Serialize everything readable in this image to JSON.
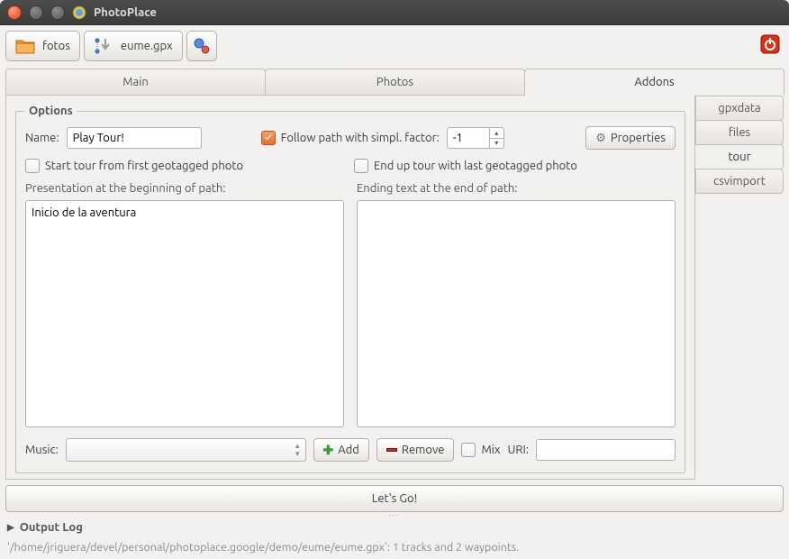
{
  "window": {
    "title": "PhotoPlace"
  },
  "toolbar": {
    "fotos_label": "fotos",
    "gpx_label": "eume.gpx"
  },
  "tabs": {
    "main": "Main",
    "photos": "Photos",
    "addons": "Addons"
  },
  "side_tabs": {
    "gpxdata": "gpxdata",
    "files": "files",
    "tour": "tour",
    "csvimport": "csvimport"
  },
  "options": {
    "legend": "Options",
    "name_label": "Name:",
    "name_value": "Play Tour!",
    "follow_label": "Follow path with simpl. factor:",
    "follow_checked": true,
    "factor_value": "-1",
    "properties_label": "Properties",
    "start_label": "Start tour from first geotagged photo",
    "start_checked": false,
    "end_label": "End up tour with last geotagged photo",
    "end_checked": false,
    "presentation_label": "Presentation at the beginning of path:",
    "presentation_value": "Inicio de la aventura",
    "ending_label": "Ending text at the end of path:",
    "ending_value": "",
    "music_label": "Music:",
    "add_label": "Add",
    "remove_label": "Remove",
    "mix_label": "Mix",
    "mix_checked": false,
    "uri_label": "URI:",
    "uri_value": ""
  },
  "go_button": "Let's Go!",
  "output_log_label": "Output Log",
  "status_text": "'/home/jriguera/devel/personal/photoplace.google/demo/eume/eume.gpx': 1 tracks and 2 waypoints."
}
